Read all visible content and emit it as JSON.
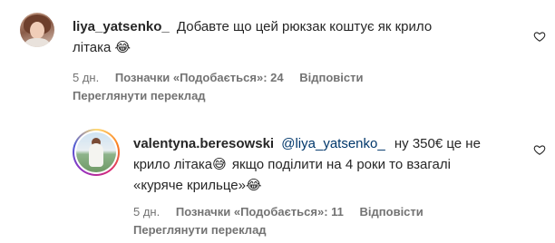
{
  "comments": [
    {
      "username": "liya_yatsenko_",
      "text_line1": "Добавте що цей рюкзак коштує як крило",
      "text_line2": "літака",
      "emoji": "😂",
      "time": "5 дн.",
      "likes": "Позначки «Подобається»: 24",
      "reply": "Відповісти",
      "translate": "Переглянути переклад"
    },
    {
      "username": "valentyna.beresowski",
      "mention": "@liya_yatsenko_",
      "text_line1": "ну 350€ це не",
      "text_line2a": "крило літака",
      "emoji1": "😅",
      "text_line2b": "якщо поділити на 4 роки то взагалі",
      "text_line3": "«куряче крильце»",
      "emoji2": "😂",
      "time": "5 дн.",
      "likes": "Позначки «Подобається»: 11",
      "reply": "Відповісти",
      "translate": "Переглянути переклад"
    }
  ],
  "icons": {
    "like": "heart-icon"
  }
}
